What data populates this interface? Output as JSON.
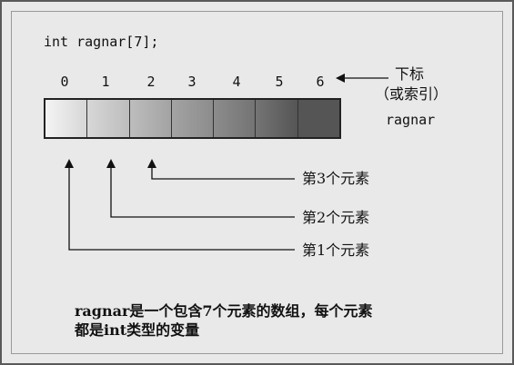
{
  "code": "int ragnar[7];",
  "indices": [
    "0",
    "1",
    "2",
    "3",
    "4",
    "5",
    "6"
  ],
  "index_label_line1": "下标",
  "index_label_line2": "（或索引）",
  "array_name": "ragnar",
  "element_labels": [
    "第3个元素",
    "第2个元素",
    "第1个元素"
  ],
  "note_line1": "ragnar是一个包含7个元素的数组，每个元素",
  "note_line2": "都是int类型的变量",
  "cell_colors": [
    "#f4f4f4",
    "#d7d7d7",
    "#bdbdbd",
    "#a3a3a3",
    "#8c8c8c",
    "#747474",
    "#555555"
  ]
}
